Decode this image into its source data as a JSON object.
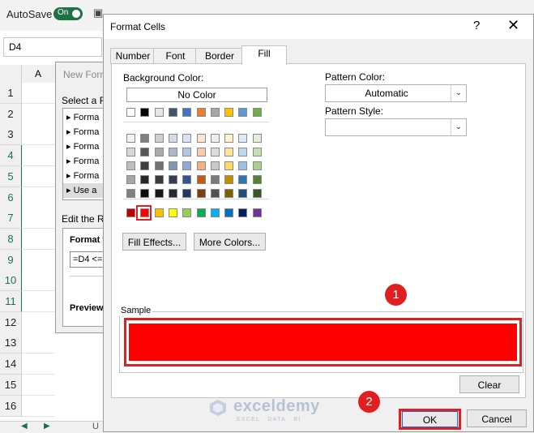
{
  "excel": {
    "autosave_label": "AutoSave",
    "toggle_label": "On",
    "namebox": "D4",
    "col_a": "A",
    "rows": [
      "1",
      "2",
      "3",
      "4",
      "5",
      "6",
      "7",
      "8",
      "9",
      "10",
      "11",
      "12",
      "13",
      "14",
      "15",
      "16"
    ],
    "sheet_tab": "U"
  },
  "new_rule_dialog": {
    "title": "New Form",
    "select_label": "Select a R",
    "rule_types": [
      "Forma",
      "Forma",
      "Forma",
      "Forma",
      "Forma",
      "Use a"
    ],
    "edit_label": "Edit the R",
    "format_label": "Format v",
    "formula_value": "=D4 <=",
    "preview_label": "Preview"
  },
  "format_cells": {
    "title": "Format Cells",
    "help": "?",
    "close": "✕",
    "tabs": [
      "Number",
      "Font",
      "Border",
      "Fill"
    ],
    "active_tab": "Fill",
    "background_color_label": "Background Color:",
    "no_color_label": "No Color",
    "fill_effects_label": "Fill Effects...",
    "more_colors_label": "More Colors...",
    "pattern_color_label": "Pattern Color:",
    "pattern_color_value": "Automatic",
    "pattern_style_label": "Pattern Style:",
    "pattern_style_value": "",
    "sample_label": "Sample",
    "sample_color": "#FF0000",
    "selected_color": "#FF0000",
    "clear_label": "Clear",
    "ok_label": "OK",
    "cancel_label": "Cancel",
    "palette": {
      "theme_top": [
        "#FFFFFF",
        "#000000",
        "#E7E6E6",
        "#44546A",
        "#4472C4",
        "#ED7D31",
        "#A5A5A5",
        "#FFC000",
        "#5B9BD5",
        "#70AD47"
      ],
      "theme_shades": [
        [
          "#F2F2F2",
          "#7F7F7F",
          "#D0CECE",
          "#D6DCE4",
          "#D9E2F3",
          "#FBE5D5",
          "#EDEDED",
          "#FFF2CC",
          "#DEEBF6",
          "#E2EFD9"
        ],
        [
          "#D8D8D8",
          "#595959",
          "#AEABAB",
          "#ADB9CA",
          "#B4C6E7",
          "#F7CBAC",
          "#DBDBDB",
          "#FFE598",
          "#BDD7EE",
          "#C5E0B3"
        ],
        [
          "#BFBFBF",
          "#3F3F3F",
          "#757070",
          "#8496B0",
          "#8EAADB",
          "#F4B183",
          "#C9C9C9",
          "#FFD965",
          "#9CC3E5",
          "#A8D08D"
        ],
        [
          "#A5A5A5",
          "#262626",
          "#3A3838",
          "#323F4F",
          "#2F5496",
          "#C55A11",
          "#7B7B7B",
          "#BF8F00",
          "#2E75B5",
          "#538135"
        ],
        [
          "#7F7F7F",
          "#0C0C0C",
          "#171616",
          "#222A35",
          "#1F3864",
          "#833C0B",
          "#525252",
          "#7F6000",
          "#1E4E79",
          "#375623"
        ]
      ],
      "standard": [
        "#C00000",
        "#FF0000",
        "#FFC000",
        "#FFFF00",
        "#92D050",
        "#00B050",
        "#00B0F0",
        "#0070C0",
        "#002060",
        "#7030A0"
      ]
    }
  },
  "annotations": {
    "badge_1": "1",
    "badge_2": "2"
  },
  "watermark": {
    "name": "exceldemy",
    "sub": "EXCEL · DATA · BI"
  }
}
